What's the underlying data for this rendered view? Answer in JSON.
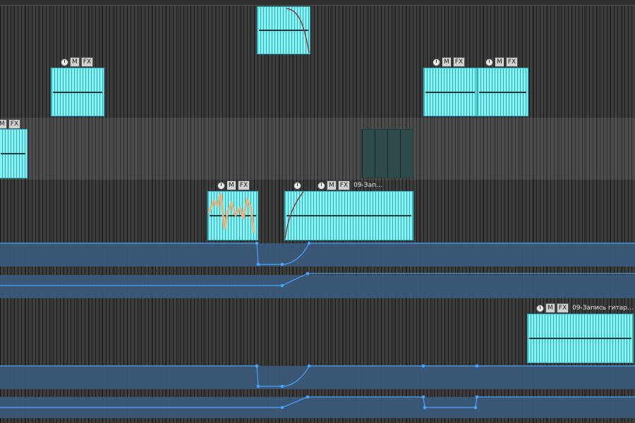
{
  "clips": {
    "c4a": {
      "name": ""
    },
    "c4b": {
      "name": "09-Зап..."
    },
    "c7": {
      "name": "09-Запись гитар..."
    }
  },
  "clip_buttons": {
    "mute": "M",
    "fx": "FX"
  },
  "icons": [
    "clock-icon"
  ],
  "colors": {
    "clip_fill": "#7ff5f7",
    "automation_lane": "#3a5a78",
    "automation_line": "#4aa3ff",
    "background": "#3d3d3d"
  }
}
